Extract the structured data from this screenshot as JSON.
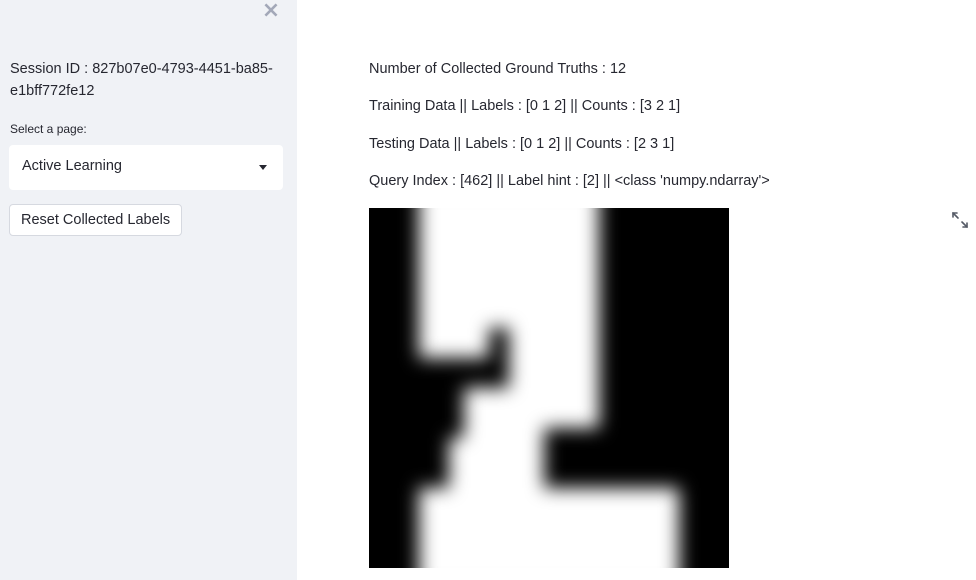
{
  "sidebar": {
    "close_icon": "close-icon",
    "session_id": "Session ID : 827b07e0-4793-4451-ba85-e1bff772fe12",
    "select_label": "Select a page:",
    "select_value": "Active Learning",
    "reset_label": "Reset Collected Labels"
  },
  "main": {
    "collected_line": "Number of Collected Ground Truths : 12",
    "training_line": "Training Data || Labels : [0 1 2] || Counts : [3 2 1]",
    "testing_line": "Testing Data || Labels : [0 1 2] || Counts : [2 3 1]",
    "query_line": "Query Index : [462] || Label hint : [2] || <class 'numpy.ndarray'>",
    "expand_icon": "fullscreen-expand-icon",
    "image_description_icon": "digit-image"
  },
  "colors": {
    "sidebar_bg": "#f0f2f6",
    "text": "#262730",
    "image_bg": "#000000",
    "image_fg": "#ffffff"
  }
}
